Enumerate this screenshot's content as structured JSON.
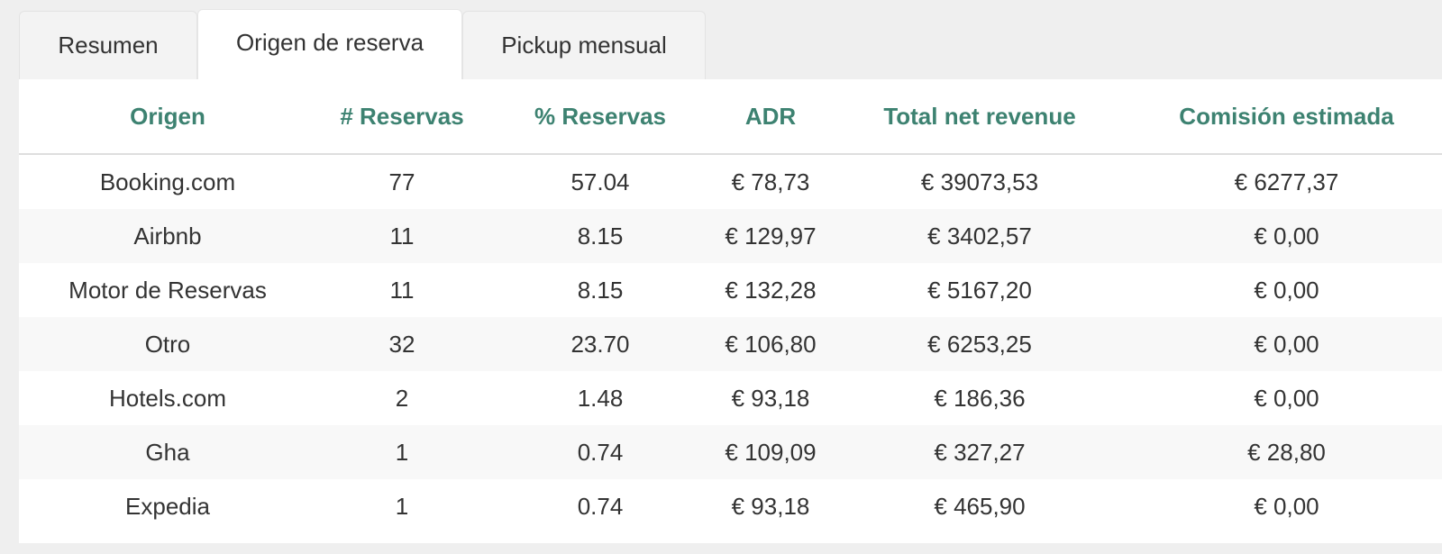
{
  "tabs": [
    {
      "label": "Resumen",
      "active": false
    },
    {
      "label": "Origen de reserva",
      "active": true
    },
    {
      "label": "Pickup mensual",
      "active": false
    }
  ],
  "table": {
    "headers": [
      "Origen",
      "# Reservas",
      "% Reservas",
      "ADR",
      "Total net revenue",
      "Comisión estimada"
    ],
    "rows": [
      [
        "Booking.com",
        "77",
        "57.04",
        "€ 78,73",
        "€ 39073,53",
        "€ 6277,37"
      ],
      [
        "Airbnb",
        "11",
        "8.15",
        "€ 129,97",
        "€ 3402,57",
        "€ 0,00"
      ],
      [
        "Motor de Reservas",
        "11",
        "8.15",
        "€ 132,28",
        "€ 5167,20",
        "€ 0,00"
      ],
      [
        "Otro",
        "32",
        "23.70",
        "€ 106,80",
        "€ 6253,25",
        "€ 0,00"
      ],
      [
        "Hotels.com",
        "2",
        "1.48",
        "€ 93,18",
        "€ 186,36",
        "€ 0,00"
      ],
      [
        "Gha",
        "1",
        "0.74",
        "€ 109,09",
        "€ 327,27",
        "€ 28,80"
      ],
      [
        "Expedia",
        "1",
        "0.74",
        "€ 93,18",
        "€ 465,90",
        "€ 0,00"
      ]
    ]
  },
  "colors": {
    "header_text": "#3d8271",
    "text": "#333333",
    "page_bg": "#efefef",
    "stripe": "#f8f8f8"
  }
}
